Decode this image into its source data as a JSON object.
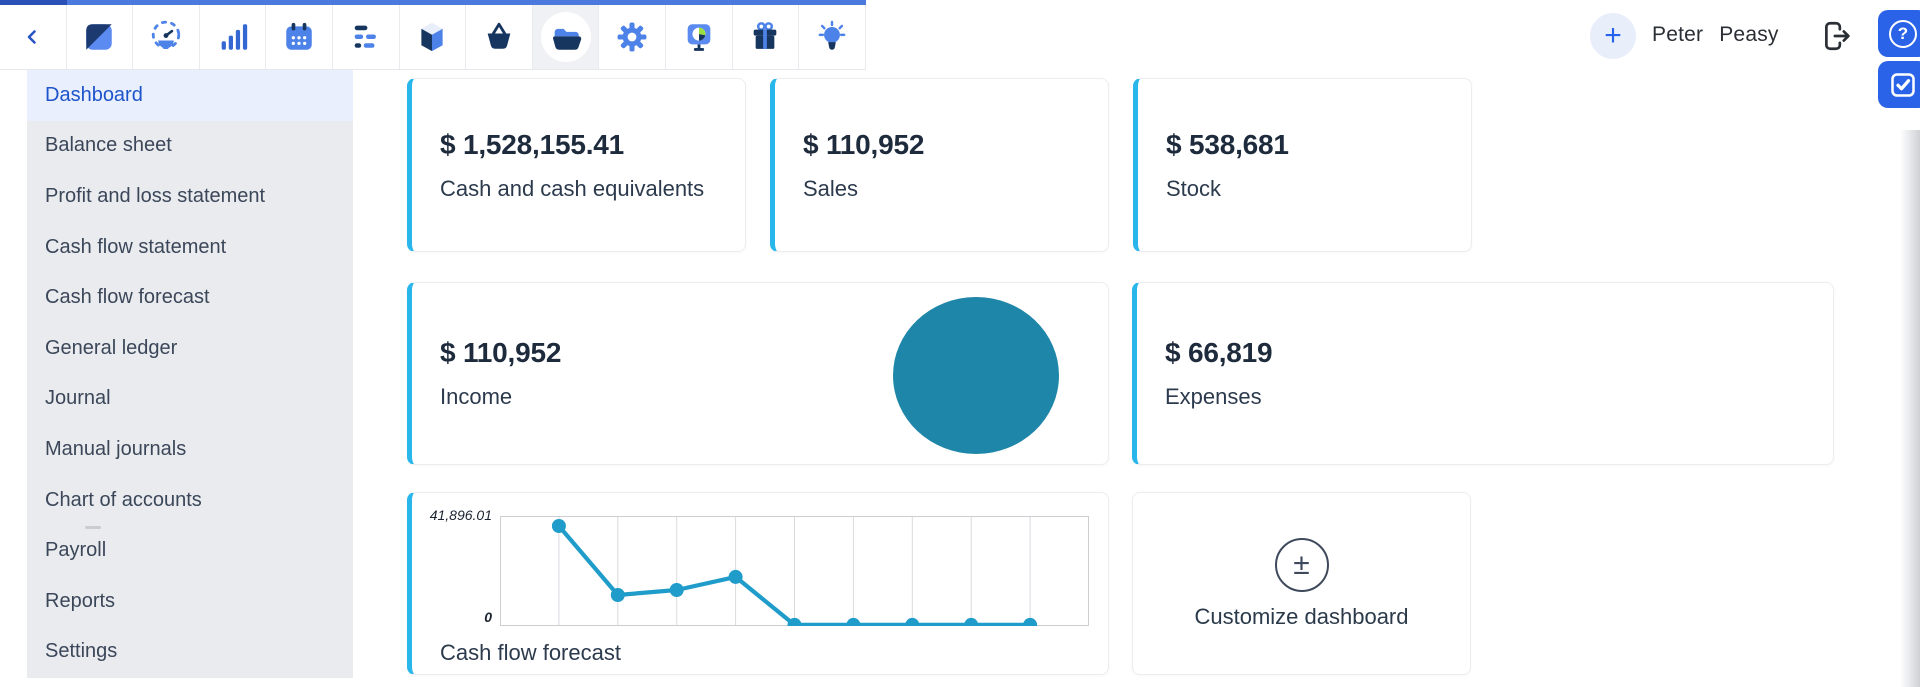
{
  "topbar": {
    "back_icon": "chevron-left",
    "apps": [
      {
        "name": "diary",
        "active": false
      },
      {
        "name": "dashboard-gauge",
        "active": false
      },
      {
        "name": "bar-chart",
        "active": false
      },
      {
        "name": "calendar",
        "active": false
      },
      {
        "name": "planner",
        "active": false
      },
      {
        "name": "inventory-book",
        "active": false
      },
      {
        "name": "basket",
        "active": false
      },
      {
        "name": "documents-folder",
        "active": true
      },
      {
        "name": "settings-gear",
        "active": false
      },
      {
        "name": "presentation",
        "active": false
      },
      {
        "name": "rewards-gift",
        "active": false
      },
      {
        "name": "ideas-bulb",
        "active": false
      }
    ],
    "add_button_label": "+",
    "user_name": "Peter Peasy",
    "logout_icon": "logout-door"
  },
  "floating_buttons": {
    "help_label": "?",
    "tasks_icon": "checkmark"
  },
  "sidebar": {
    "items": [
      {
        "label": "Dashboard",
        "active": true
      },
      {
        "label": "Balance sheet",
        "active": false
      },
      {
        "label": "Profit and loss statement",
        "active": false
      },
      {
        "label": "Cash flow statement",
        "active": false
      },
      {
        "label": "Cash flow forecast",
        "active": false
      },
      {
        "label": "General ledger",
        "active": false
      },
      {
        "label": "Journal",
        "active": false
      },
      {
        "label": "Manual journals",
        "active": false
      },
      {
        "label": "Chart of accounts",
        "active": false
      },
      {
        "label": "Payroll",
        "active": false
      },
      {
        "label": "Reports",
        "active": false
      },
      {
        "label": "Settings",
        "active": false
      }
    ]
  },
  "main": {
    "kpi_cards_row1": [
      {
        "value": "$ 1,528,155.41",
        "label": "Cash and cash equivalents"
      },
      {
        "value": "$ 110,952",
        "label": "Sales"
      },
      {
        "value": "$ 538,681",
        "label": "Stock"
      }
    ],
    "kpi_cards_row2": [
      {
        "value": "$ 110,952",
        "label": "Income",
        "has_pie": true
      },
      {
        "value": "$ 66,819",
        "label": "Expenses",
        "has_pie": false
      }
    ],
    "cash_flow_card": {
      "title": "Cash flow forecast",
      "y_axis_max_label": "41,896.01",
      "y_axis_min_label": "0"
    },
    "customize_card": {
      "label": "Customize dashboard",
      "icon_symbol": "±"
    }
  },
  "colors": {
    "accent_cyan": "#29b6ea",
    "pie_teal": "#1e86a8",
    "chart_line": "#1f9cc9",
    "active_blue": "#1d53cb",
    "button_blue": "#2b63e8"
  },
  "chart_data": [
    {
      "type": "line",
      "title": "Cash flow forecast",
      "x": [
        1,
        2,
        3,
        4,
        5,
        6,
        7,
        8,
        9
      ],
      "values": [
        38100,
        11800,
        13700,
        18700,
        400,
        400,
        400,
        400,
        400
      ],
      "ylim": [
        0,
        41896.01
      ],
      "y_tick_labels": [
        "0",
        "41,896.01"
      ],
      "grid": "vertical",
      "grid_divisions": 10,
      "legend": "none"
    },
    {
      "type": "pie",
      "title": "Income",
      "slices": [
        {
          "label": "Income",
          "value": 110952
        }
      ],
      "total_label": "$ 110,952"
    }
  ]
}
